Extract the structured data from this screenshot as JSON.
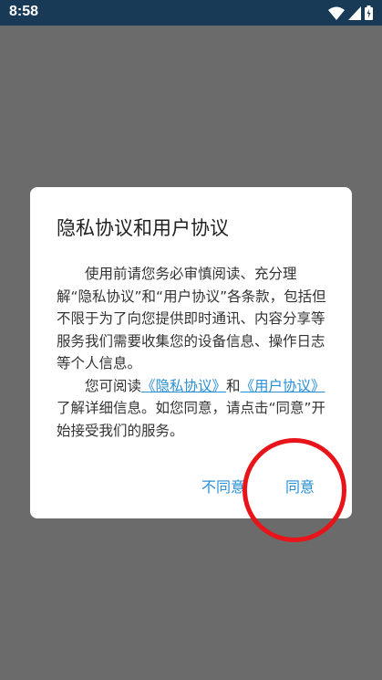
{
  "status_bar": {
    "time": "8:58",
    "icons": [
      "wifi-icon",
      "signal-icon",
      "battery-icon"
    ]
  },
  "dialog": {
    "title": "隐私协议和用户协议",
    "paragraph1": "使用前请您务必审慎阅读、充分理解“隐私协议”和“用户协议”各条款，包括但不限于为了向您提供即时通讯、内容分享等服务我们需要收集您的设备信息、操作日志等个人信息。",
    "paragraph2_prefix": "您可阅读",
    "privacy_link": "《隐私协议》",
    "paragraph2_and": "和",
    "user_link": "《用户协议》",
    "paragraph2_suffix": "了解详细信息。如您同意，请点击“同意”开始接受我们的服务。",
    "disagree_label": "不同意",
    "agree_label": "同意"
  },
  "colors": {
    "accent": "#2a8fd6",
    "status_bar": "#193a57",
    "overlay": "#6b6b6b",
    "annotation": "#e8141a"
  }
}
